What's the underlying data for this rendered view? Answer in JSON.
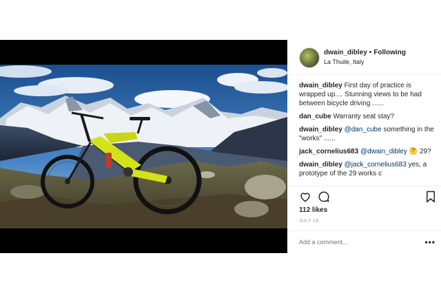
{
  "post": {
    "author": "dwain_dibley",
    "separator": "•",
    "follow_status": "Following",
    "location": "La Thuile, Italy",
    "comments": [
      {
        "user": "dwain_dibley",
        "text": "First day of practice is wrapped up.... Stunning views to be had between bicycle driving ......"
      },
      {
        "user": "dan_cube",
        "text": "Warranty seat stay?"
      },
      {
        "user": "dwain_dibley",
        "mention": "@dan_cube",
        "text": "something in the \"works\" ......"
      },
      {
        "user": "jack_cornelius683",
        "mention": "@dwain_dibley",
        "emoji": "🤔",
        "text": "29?"
      },
      {
        "user": "dwain_dibley",
        "mention": "@jack_cornelius683",
        "text": "yes, a prototype of the 29 works c"
      }
    ],
    "likes": "112 likes",
    "date": "JULY 19",
    "add_comment_placeholder": "Add a comment...",
    "more_options": "•••"
  },
  "icons": {
    "like": "heart-icon",
    "comment": "comment-bubble-icon",
    "save": "bookmark-icon"
  },
  "colors": {
    "mention": "#003569",
    "bike_accent": "#d4e21a"
  }
}
